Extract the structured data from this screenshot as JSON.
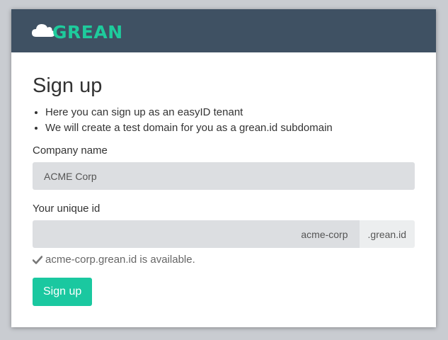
{
  "header": {
    "logo_text": "GREAN"
  },
  "page": {
    "title": "Sign up",
    "bullets": [
      "Here you can sign up as an easyID tenant",
      "We will create a test domain for you as a grean.id subdomain"
    ]
  },
  "form": {
    "company": {
      "label": "Company name",
      "value": "ACME Corp"
    },
    "unique_id": {
      "label": "Your unique id",
      "value": "acme-corp",
      "suffix": ".grean.id"
    },
    "availability": "acme-corp.grean.id is available.",
    "submit_label": "Sign up"
  },
  "colors": {
    "header_bg": "#3f5163",
    "brand": "#1ecb9c",
    "button": "#1ac8a0"
  },
  "icons": {
    "logo": "cloud-icon",
    "availability": "check-icon"
  }
}
